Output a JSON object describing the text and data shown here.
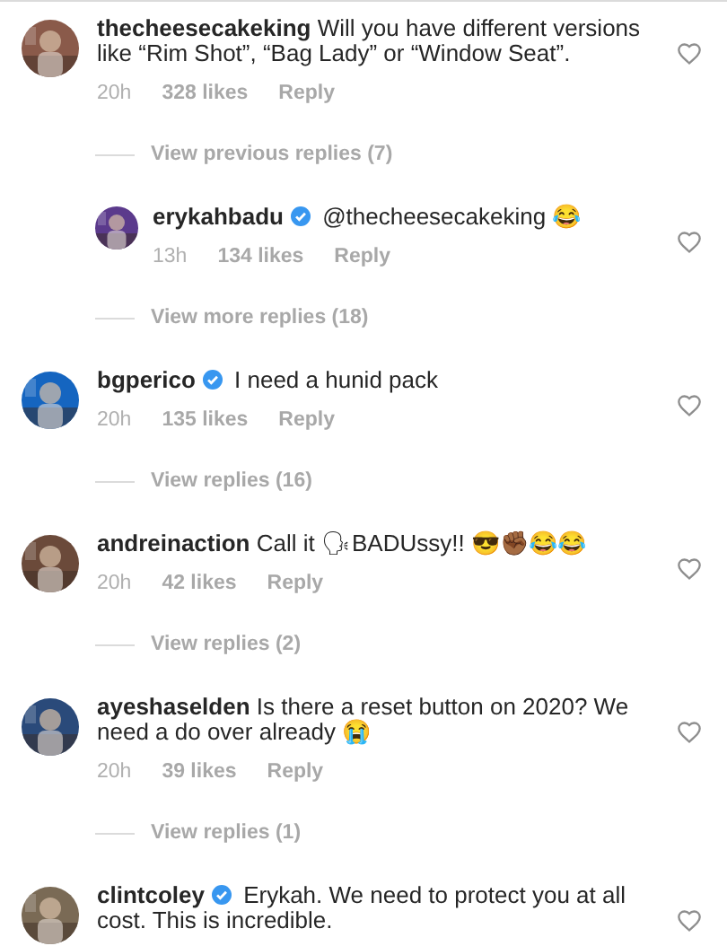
{
  "items": [
    {
      "kind": "comment",
      "username": "thecheesecakeking",
      "verified": false,
      "text": "Will you have different versions like “Rim Shot”, “Bag Lady” or “Window Seat”.",
      "time": "20h",
      "likes": "328 likes",
      "reply": "Reply"
    },
    {
      "kind": "view_replies",
      "label": "View previous replies (7)"
    },
    {
      "kind": "reply",
      "username": "erykahbadu",
      "verified": true,
      "text": "@thecheesecakeking 😂",
      "time": "13h",
      "likes": "134 likes",
      "reply": "Reply"
    },
    {
      "kind": "view_replies",
      "label": "View more replies (18)"
    },
    {
      "kind": "comment",
      "username": "bgperico",
      "verified": true,
      "text": "I need a hunid pack",
      "time": "20h",
      "likes": "135 likes",
      "reply": "Reply"
    },
    {
      "kind": "view_replies",
      "label": "View replies (16)"
    },
    {
      "kind": "comment",
      "username": "andreinaction",
      "verified": false,
      "text": "Call it 🗣BADUssy!! 😎✊🏾😂😂",
      "time": "20h",
      "likes": "42 likes",
      "reply": "Reply"
    },
    {
      "kind": "view_replies",
      "label": "View replies (2)"
    },
    {
      "kind": "comment",
      "username": "ayeshaselden",
      "verified": false,
      "text": "Is there a reset button on 2020? We need a do over already 😭",
      "time": "20h",
      "likes": "39 likes",
      "reply": "Reply"
    },
    {
      "kind": "view_replies",
      "label": "View replies (1)"
    },
    {
      "kind": "comment",
      "username": "clintcoley",
      "verified": true,
      "text": "Erykah. We need to protect you at all cost. This is incredible."
    }
  ]
}
